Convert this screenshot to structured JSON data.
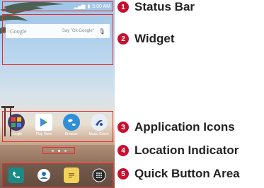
{
  "status_bar": {
    "time": "5:00 AM"
  },
  "widget": {
    "search_logo": "Google",
    "search_hint": "Say \"Ok Google\""
  },
  "apps": [
    {
      "label": "Google",
      "color": "#4a3a6a"
    },
    {
      "label": "Play Store",
      "color": "#ffffff"
    },
    {
      "label": "Browser",
      "color": "#2f8fd8"
    },
    {
      "label": "Music Grove",
      "color": "#e8eef5"
    }
  ],
  "location_indicator": {
    "pages": 3,
    "current": 2
  },
  "quick_buttons": [
    {
      "name": "phone",
      "color": "#1a8a86"
    },
    {
      "name": "contacts",
      "color": "#2c6fbf"
    },
    {
      "name": "messaging",
      "color": "#f2d25a"
    },
    {
      "name": "apps",
      "color": "#2a2a2a"
    }
  ],
  "callouts": [
    {
      "number": "1",
      "label": "Status Bar"
    },
    {
      "number": "2",
      "label": "Widget"
    },
    {
      "number": "3",
      "label": "Application Icons"
    },
    {
      "number": "4",
      "label": "Location Indicator"
    },
    {
      "number": "5",
      "label": "Quick Button Area"
    }
  ],
  "colors": {
    "callout_red": "#c8102e",
    "highlight_border": "#e62c2c"
  }
}
